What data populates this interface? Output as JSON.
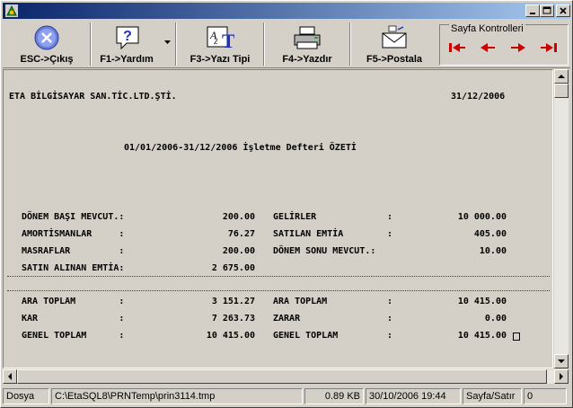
{
  "toolbar": {
    "esc_label": "ESC->Çıkış",
    "f1_label": "F1->Yardım",
    "f3_label": "F3->Yazı Tipi",
    "f4_label": "F4->Yazdır",
    "f5_label": "F5->Postala",
    "page_controls_title": "Sayfa Kontrolleri"
  },
  "report": {
    "company": "ETA BİLGİSAYAR SAN.TİC.LTD.ŞTİ.",
    "date": "31/12/2006",
    "heading": "01/01/2006-31/12/2006 İşletme Defteri ÖZETİ",
    "rows_top": [
      {
        "l_label": "DÖNEM BAŞI MEVCUT.:",
        "l_value": "200.00",
        "r_label": "GELİRLER",
        "r_colon": ":",
        "r_value": "10 000.00"
      },
      {
        "l_label": "AMORTİSMANLAR     :",
        "l_value": "76.27",
        "r_label": "SATILAN EMTİA",
        "r_colon": ":",
        "r_value": "405.00"
      },
      {
        "l_label": "MASRAFLAR         :",
        "l_value": "200.00",
        "r_label": "DÖNEM SONU MEVCUT.:",
        "r_colon": "",
        "r_value": "10.00"
      },
      {
        "l_label": "SATIN ALINAN EMTİA:",
        "l_value": "2 675.00",
        "r_label": "",
        "r_colon": "",
        "r_value": ""
      }
    ],
    "rows_bottom": [
      {
        "l_label": "ARA TOPLAM        :",
        "l_value": "3 151.27",
        "r_label": "ARA TOPLAM",
        "r_colon": ":",
        "r_value": "10 415.00"
      },
      {
        "l_label": "KAR               :",
        "l_value": "7 263.73",
        "r_label": "ZARAR",
        "r_colon": ":",
        "r_value": "0.00"
      },
      {
        "l_label": "GENEL TOPLAM      :",
        "l_value": "10 415.00",
        "r_label": "GENEL TOPLAM",
        "r_colon": ":",
        "r_value": "10 415.00"
      }
    ]
  },
  "status": {
    "menu": "Dosya",
    "path": "C:\\EtaSQL8\\PRNTemp\\prin3114.tmp",
    "size": "0.89 KB",
    "datetime": "30/10/2006 19:44",
    "mode": "Sayfa/Satır",
    "position": "0"
  },
  "colors": {
    "title_start": "#0a246a",
    "title_end": "#a6caf0",
    "nav_arrow": "#cc0000",
    "face": "#d4d0c8"
  },
  "icons": [
    "app-icon",
    "minimize-icon",
    "maximize-icon",
    "close-icon",
    "exit-icon",
    "help-icon",
    "font-icon",
    "printer-icon",
    "mail-icon",
    "first-page-icon",
    "prev-page-icon",
    "next-page-icon",
    "last-page-icon"
  ]
}
